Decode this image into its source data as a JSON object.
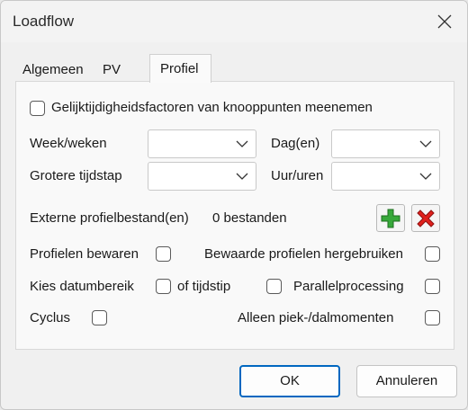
{
  "window": {
    "title": "Loadflow"
  },
  "tabs": [
    {
      "label": "Algemeen"
    },
    {
      "label": "PV"
    },
    {
      "label": "Profiel"
    }
  ],
  "profiel": {
    "simultaneity_label": "Gelijktijdigheidsfactoren van knooppunten meenemen",
    "simultaneity_checked": false,
    "weeks_label": "Week/weken",
    "weeks_value": "",
    "days_label": "Dag(en)",
    "days_value": "",
    "timestep_label": "Grotere tijdstap",
    "timestep_value": "",
    "hours_label": "Uur/uren",
    "hours_value": "",
    "external_files_label": "Externe profielbestand(en)",
    "external_files_count": "0 bestanden",
    "save_profiles_label": "Profielen bewaren",
    "reuse_profiles_label": "Bewaarde profielen hergebruiken",
    "date_range_label": "Kies datumbereik",
    "timestamp_label": "of tijdstip",
    "parallel_label": "Parallelprocessing",
    "cycle_label": "Cyclus",
    "peak_label": "Alleen piek-/dalmomenten"
  },
  "buttons": {
    "ok": "OK",
    "cancel": "Annuleren"
  },
  "colors": {
    "accent": "#0067c0",
    "add": "#2e9e2e",
    "remove": "#e0201c"
  }
}
